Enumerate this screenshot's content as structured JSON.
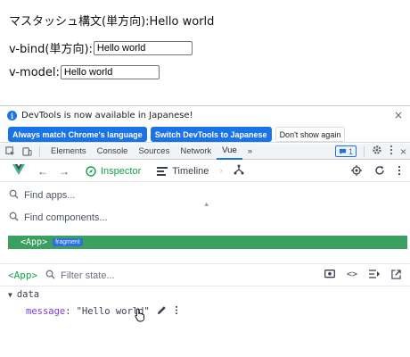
{
  "page": {
    "line1": "マスタッシュ構文(単方向):Hello world",
    "vbind_label": "v-bind(単方向):",
    "vbind_value": "Hello world",
    "vmodel_label": "v-model:",
    "vmodel_value": "Hello world"
  },
  "infobar": {
    "message": "DevTools is now available in Japanese!",
    "buttons": {
      "match": "Always match Chrome's language",
      "switch": "Switch DevTools to Japanese",
      "dismiss": "Don't show again"
    }
  },
  "tabs": {
    "items": [
      "Elements",
      "Console",
      "Sources",
      "Network",
      "Vue"
    ],
    "active": "Vue",
    "more": "»",
    "issues_count": "1"
  },
  "vue": {
    "inspector_label": "Inspector",
    "timeline_label": "Timeline"
  },
  "search": {
    "apps_placeholder": "Find apps...",
    "components_placeholder": "Find components..."
  },
  "tree": {
    "app_tag": "<App>",
    "fragment_label": "fragment"
  },
  "state": {
    "app_tag": "<App>",
    "filter_placeholder": "Filter state...",
    "section": "data",
    "key": "message",
    "value": "\"Hello world\""
  },
  "colors": {
    "accent_blue": "#1a73e8",
    "vue_green": "#3aa05f",
    "fragment_blue": "#2f6fde",
    "key_purple": "#7c3aed"
  }
}
